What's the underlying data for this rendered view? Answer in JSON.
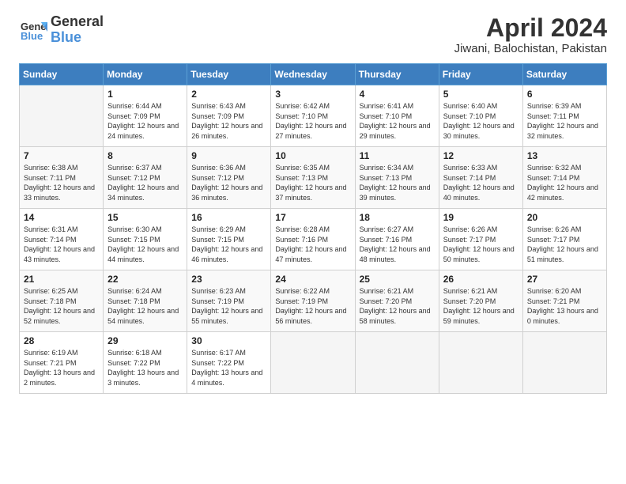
{
  "header": {
    "logo_line1": "General",
    "logo_line2": "Blue",
    "month": "April 2024",
    "location": "Jiwani, Balochistan, Pakistan"
  },
  "weekdays": [
    "Sunday",
    "Monday",
    "Tuesday",
    "Wednesday",
    "Thursday",
    "Friday",
    "Saturday"
  ],
  "weeks": [
    [
      {
        "num": "",
        "sunrise": "",
        "sunset": "",
        "daylight": ""
      },
      {
        "num": "1",
        "sunrise": "Sunrise: 6:44 AM",
        "sunset": "Sunset: 7:09 PM",
        "daylight": "Daylight: 12 hours and 24 minutes."
      },
      {
        "num": "2",
        "sunrise": "Sunrise: 6:43 AM",
        "sunset": "Sunset: 7:09 PM",
        "daylight": "Daylight: 12 hours and 26 minutes."
      },
      {
        "num": "3",
        "sunrise": "Sunrise: 6:42 AM",
        "sunset": "Sunset: 7:10 PM",
        "daylight": "Daylight: 12 hours and 27 minutes."
      },
      {
        "num": "4",
        "sunrise": "Sunrise: 6:41 AM",
        "sunset": "Sunset: 7:10 PM",
        "daylight": "Daylight: 12 hours and 29 minutes."
      },
      {
        "num": "5",
        "sunrise": "Sunrise: 6:40 AM",
        "sunset": "Sunset: 7:10 PM",
        "daylight": "Daylight: 12 hours and 30 minutes."
      },
      {
        "num": "6",
        "sunrise": "Sunrise: 6:39 AM",
        "sunset": "Sunset: 7:11 PM",
        "daylight": "Daylight: 12 hours and 32 minutes."
      }
    ],
    [
      {
        "num": "7",
        "sunrise": "Sunrise: 6:38 AM",
        "sunset": "Sunset: 7:11 PM",
        "daylight": "Daylight: 12 hours and 33 minutes."
      },
      {
        "num": "8",
        "sunrise": "Sunrise: 6:37 AM",
        "sunset": "Sunset: 7:12 PM",
        "daylight": "Daylight: 12 hours and 34 minutes."
      },
      {
        "num": "9",
        "sunrise": "Sunrise: 6:36 AM",
        "sunset": "Sunset: 7:12 PM",
        "daylight": "Daylight: 12 hours and 36 minutes."
      },
      {
        "num": "10",
        "sunrise": "Sunrise: 6:35 AM",
        "sunset": "Sunset: 7:13 PM",
        "daylight": "Daylight: 12 hours and 37 minutes."
      },
      {
        "num": "11",
        "sunrise": "Sunrise: 6:34 AM",
        "sunset": "Sunset: 7:13 PM",
        "daylight": "Daylight: 12 hours and 39 minutes."
      },
      {
        "num": "12",
        "sunrise": "Sunrise: 6:33 AM",
        "sunset": "Sunset: 7:14 PM",
        "daylight": "Daylight: 12 hours and 40 minutes."
      },
      {
        "num": "13",
        "sunrise": "Sunrise: 6:32 AM",
        "sunset": "Sunset: 7:14 PM",
        "daylight": "Daylight: 12 hours and 42 minutes."
      }
    ],
    [
      {
        "num": "14",
        "sunrise": "Sunrise: 6:31 AM",
        "sunset": "Sunset: 7:14 PM",
        "daylight": "Daylight: 12 hours and 43 minutes."
      },
      {
        "num": "15",
        "sunrise": "Sunrise: 6:30 AM",
        "sunset": "Sunset: 7:15 PM",
        "daylight": "Daylight: 12 hours and 44 minutes."
      },
      {
        "num": "16",
        "sunrise": "Sunrise: 6:29 AM",
        "sunset": "Sunset: 7:15 PM",
        "daylight": "Daylight: 12 hours and 46 minutes."
      },
      {
        "num": "17",
        "sunrise": "Sunrise: 6:28 AM",
        "sunset": "Sunset: 7:16 PM",
        "daylight": "Daylight: 12 hours and 47 minutes."
      },
      {
        "num": "18",
        "sunrise": "Sunrise: 6:27 AM",
        "sunset": "Sunset: 7:16 PM",
        "daylight": "Daylight: 12 hours and 48 minutes."
      },
      {
        "num": "19",
        "sunrise": "Sunrise: 6:26 AM",
        "sunset": "Sunset: 7:17 PM",
        "daylight": "Daylight: 12 hours and 50 minutes."
      },
      {
        "num": "20",
        "sunrise": "Sunrise: 6:26 AM",
        "sunset": "Sunset: 7:17 PM",
        "daylight": "Daylight: 12 hours and 51 minutes."
      }
    ],
    [
      {
        "num": "21",
        "sunrise": "Sunrise: 6:25 AM",
        "sunset": "Sunset: 7:18 PM",
        "daylight": "Daylight: 12 hours and 52 minutes."
      },
      {
        "num": "22",
        "sunrise": "Sunrise: 6:24 AM",
        "sunset": "Sunset: 7:18 PM",
        "daylight": "Daylight: 12 hours and 54 minutes."
      },
      {
        "num": "23",
        "sunrise": "Sunrise: 6:23 AM",
        "sunset": "Sunset: 7:19 PM",
        "daylight": "Daylight: 12 hours and 55 minutes."
      },
      {
        "num": "24",
        "sunrise": "Sunrise: 6:22 AM",
        "sunset": "Sunset: 7:19 PM",
        "daylight": "Daylight: 12 hours and 56 minutes."
      },
      {
        "num": "25",
        "sunrise": "Sunrise: 6:21 AM",
        "sunset": "Sunset: 7:20 PM",
        "daylight": "Daylight: 12 hours and 58 minutes."
      },
      {
        "num": "26",
        "sunrise": "Sunrise: 6:21 AM",
        "sunset": "Sunset: 7:20 PM",
        "daylight": "Daylight: 12 hours and 59 minutes."
      },
      {
        "num": "27",
        "sunrise": "Sunrise: 6:20 AM",
        "sunset": "Sunset: 7:21 PM",
        "daylight": "Daylight: 13 hours and 0 minutes."
      }
    ],
    [
      {
        "num": "28",
        "sunrise": "Sunrise: 6:19 AM",
        "sunset": "Sunset: 7:21 PM",
        "daylight": "Daylight: 13 hours and 2 minutes."
      },
      {
        "num": "29",
        "sunrise": "Sunrise: 6:18 AM",
        "sunset": "Sunset: 7:22 PM",
        "daylight": "Daylight: 13 hours and 3 minutes."
      },
      {
        "num": "30",
        "sunrise": "Sunrise: 6:17 AM",
        "sunset": "Sunset: 7:22 PM",
        "daylight": "Daylight: 13 hours and 4 minutes."
      },
      {
        "num": "",
        "sunrise": "",
        "sunset": "",
        "daylight": ""
      },
      {
        "num": "",
        "sunrise": "",
        "sunset": "",
        "daylight": ""
      },
      {
        "num": "",
        "sunrise": "",
        "sunset": "",
        "daylight": ""
      },
      {
        "num": "",
        "sunrise": "",
        "sunset": "",
        "daylight": ""
      }
    ]
  ]
}
